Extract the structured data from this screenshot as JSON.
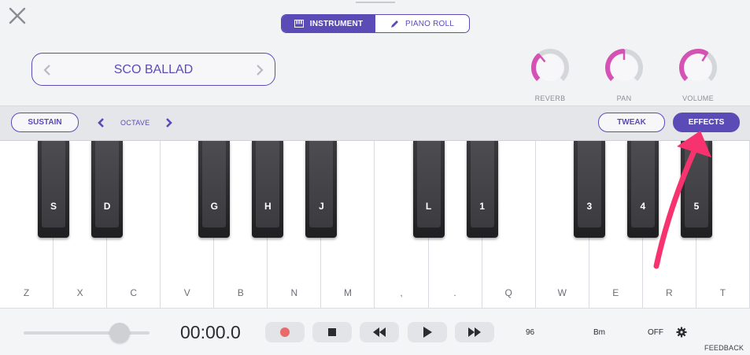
{
  "header": {
    "mode_tabs": [
      {
        "label": "INSTRUMENT",
        "active": true,
        "icon": "piano-icon"
      },
      {
        "label": "PIANO ROLL",
        "active": false,
        "icon": "pencil-icon"
      }
    ],
    "preset": {
      "name": "SCO BALLAD"
    },
    "knobs": [
      {
        "label": "REVERB",
        "level": 0.35
      },
      {
        "label": "PAN",
        "level": 0.5
      },
      {
        "label": "VOLUME",
        "level": 0.62
      }
    ]
  },
  "controls": {
    "sustain_label": "SUSTAIN",
    "octave_label": "OCTAVE",
    "tweak_label": "TWEAK",
    "effects_label": "EFFECTS"
  },
  "keyboard": {
    "white_keys": [
      "Z",
      "X",
      "C",
      "V",
      "B",
      "N",
      "M",
      ",",
      ".",
      "Q",
      "W",
      "E",
      "R",
      "T"
    ],
    "black_keys": [
      "S",
      "D",
      "G",
      "H",
      "J",
      "L",
      "1",
      "3",
      "4",
      "5"
    ]
  },
  "transport": {
    "time": "00:00.0",
    "tempo": "96",
    "key": "Bm",
    "metronome": "OFF",
    "feedback_label": "FEEDBACK",
    "record_color": "#e86a6a"
  },
  "colors": {
    "accent": "#5b4bb7",
    "knob_fill": "#d552b4",
    "annotation_arrow": "#f7336f"
  }
}
